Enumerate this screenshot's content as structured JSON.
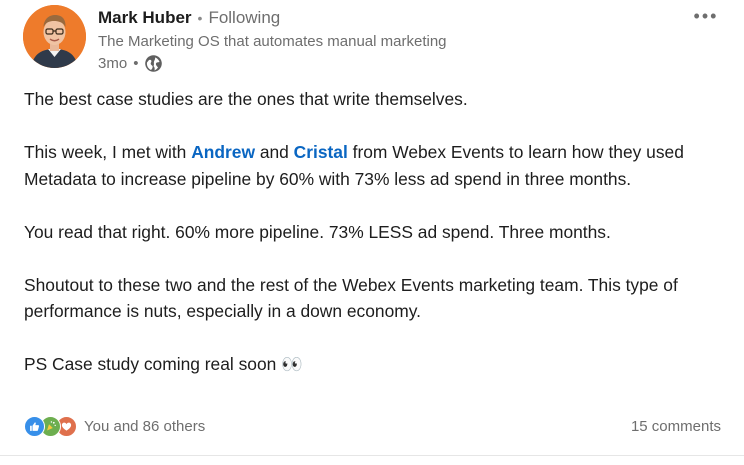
{
  "author": {
    "name": "Mark Huber",
    "separator": "•",
    "follow_status": "Following",
    "headline": "The Marketing OS that automates manual marketing",
    "time_ago": "3mo",
    "time_separator": "•",
    "visibility_icon": "globe-icon"
  },
  "menu": {
    "more_label": "•••"
  },
  "post": {
    "line1": "The best case studies are the ones that write themselves.",
    "p2_before": "This week, I met with ",
    "mention1": "Andrew",
    "p2_and": " and ",
    "mention2": "Cristal",
    "p2_after": " from Webex Events to learn how they used Metadata to increase pipeline by 60% with 73% less ad spend in three months.",
    "line3": "You read that right. 60% more pipeline. 73% LESS ad spend. Three months.",
    "line4": "Shoutout to these two and the rest of the Webex Events marketing team. This type of performance is nuts, especially in a down economy.",
    "line5": "PS Case study coming real soon",
    "line5_emoji": "👀"
  },
  "social": {
    "reaction_icons": [
      "like-icon",
      "celebrate-icon",
      "love-icon"
    ],
    "reactions_text": "You and 86 others",
    "comments_text": "15 comments"
  },
  "colors": {
    "mention": "#0a66c2",
    "secondary_text": "#6e6e6e",
    "like": "#378fe9",
    "celebrate": "#6dae4f",
    "love": "#df704d",
    "avatar_bg": "#ee7b2b"
  }
}
